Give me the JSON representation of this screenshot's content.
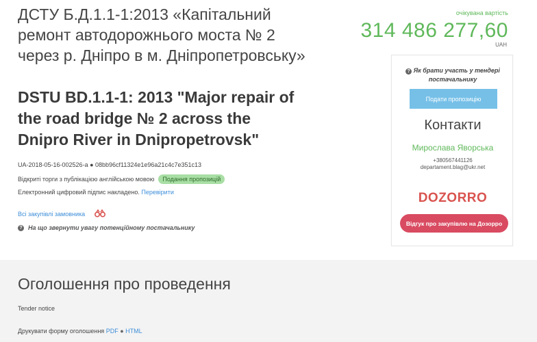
{
  "title_ua": "ДСТУ Б.Д.1.1-1:2013 «Капітальний ремонт автодорожнього моста № 2 через р. Дніпро в м. Дніпропетровську»",
  "title_en": "DSTU BD.1.1-1: 2013 \"Major repair of the road bridge № 2 across the Dnipro River in Dnipropetrovsk\"",
  "meta": {
    "id_line": "UA-2018-05-16-002526-a ● 08bb96cf11324e1e96a21c4c7e351c13",
    "open_tender_text": "Відкриті торги з публікацією англійською мовою",
    "status_badge": "Подання пропозицій",
    "signature_text": "Електронний цифровий підпис накладено.",
    "verify_link": "Перевірити"
  },
  "buyer_link": "Всі закупівлі замовника",
  "attention_text": "На що звернути увагу потенційному постачальнику",
  "price": {
    "label": "очікувана вартість",
    "value": "314 486 277,60",
    "currency": "UAH"
  },
  "card": {
    "how_to_participate": "Як брати участь у тендері постачальнику",
    "submit_button": "Подати пропозицію",
    "contacts_heading": "Контакти",
    "contact_name": "Мирослава Яворська",
    "contact_phone": "+380567441126",
    "contact_email": "departament.blag@ukr.net",
    "logo_text": "DOZORRO",
    "feedback_button": "Відгук про закупівлю на Дозорро"
  },
  "announcement": {
    "heading": "Оголошення про проведення",
    "tender_notice": "Tender notice",
    "print_text": "Друкувати форму оголошення",
    "pdf_link": "PDF",
    "separator": "●",
    "html_link": "HTML"
  },
  "colors": {
    "accent_green": "#5fb85a",
    "link_blue": "#3d8ed8",
    "submit_blue": "#76c0e8",
    "dozorro_red": "#d94b61"
  }
}
